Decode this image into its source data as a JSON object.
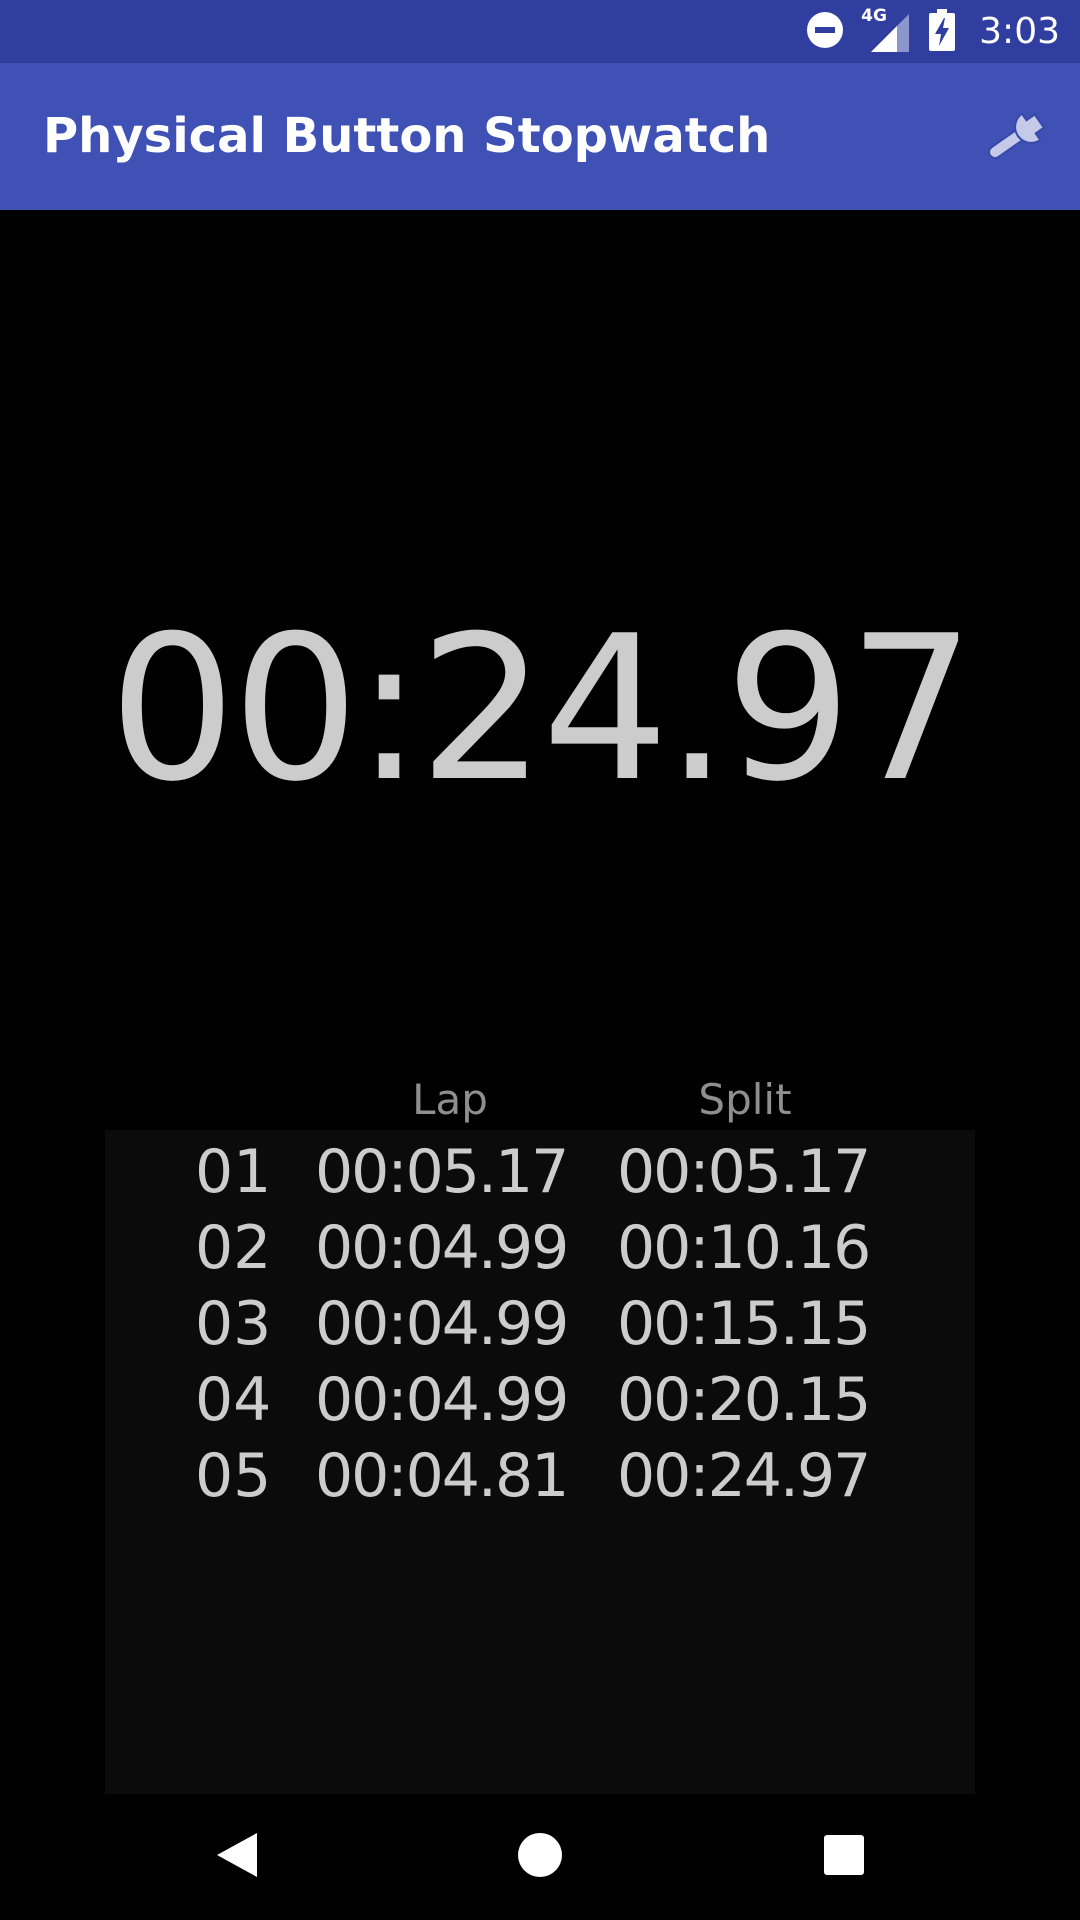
{
  "status_bar": {
    "network_label": "4G",
    "time": "3:03",
    "icons": [
      "do-not-disturb-icon",
      "signal-4g-icon",
      "battery-charging-icon"
    ]
  },
  "app_bar": {
    "title": "Physical Button Stopwatch",
    "settings_icon": "wrench-icon"
  },
  "timer": {
    "elapsed": "00:24.97"
  },
  "laps": {
    "headers": {
      "lap": "Lap",
      "split": "Split"
    },
    "rows": [
      {
        "num": "01",
        "lap": "00:05.17",
        "split": "00:05.17"
      },
      {
        "num": "02",
        "lap": "00:04.99",
        "split": "00:10.16"
      },
      {
        "num": "03",
        "lap": "00:04.99",
        "split": "00:15.15"
      },
      {
        "num": "04",
        "lap": "00:04.99",
        "split": "00:20.15"
      },
      {
        "num": "05",
        "lap": "00:04.81",
        "split": "00:24.97"
      }
    ]
  },
  "nav_bar": {
    "icons": [
      "back-icon",
      "home-icon",
      "recents-icon"
    ]
  },
  "colors": {
    "status_bar": "#303f9f",
    "app_bar": "#3f51b5",
    "background": "#000000",
    "text_primary": "#cccccc",
    "text_header": "#8f8f8f",
    "panel": "#0b0b0b"
  }
}
